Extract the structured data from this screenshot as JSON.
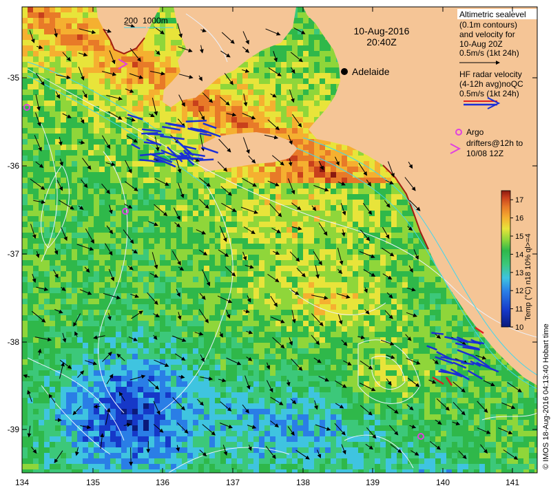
{
  "map": {
    "date_line": "10-Aug-2016",
    "time_line": "20:40Z",
    "depth_legend": {
      "label_200": "200",
      "label_1000": "1000m"
    },
    "city": {
      "name": "Adelaide"
    },
    "x_ticks": [
      "134",
      "135",
      "136",
      "137",
      "138",
      "139",
      "140",
      "141"
    ],
    "y_ticks": [
      "-35",
      "-36",
      "-37",
      "-38",
      "-39"
    ],
    "legend": {
      "altimetric_lines": [
        "Altimetric sealevel",
        "(0.1m contours)",
        "and velocity for",
        "10-Aug 20Z",
        "0.5m/s (1kt 24h)"
      ],
      "hf_lines": [
        "HF radar velocity",
        "(4-12h avg)noQC",
        "0.5m/s (1kt 24h)"
      ],
      "argo_lines": [
        "Argo",
        "drifters@12h to",
        "10/08 12Z"
      ]
    },
    "colorbar": {
      "ticks": [
        "10",
        "11",
        "12",
        "13",
        "14",
        "15",
        "16",
        "17"
      ],
      "label": "Temp (°C) n18 10% ql>=4",
      "min": 10,
      "max": 17.5,
      "colors": [
        "#0b1a7a",
        "#1638c8",
        "#2a7ee6",
        "#3fc4e0",
        "#3cc87a",
        "#2fb84a",
        "#8fd63a",
        "#e8e43a",
        "#f5b030",
        "#e87a28",
        "#c8401c",
        "#8a1a10"
      ]
    },
    "credit": "© IMOS 18-Aug-2016 04:13:40 Hobart time",
    "colors": {
      "land": "#f5c596",
      "argo": "#e040e0",
      "hf_blue": "#1a2fd6",
      "hf_red": "#e02020"
    }
  }
}
